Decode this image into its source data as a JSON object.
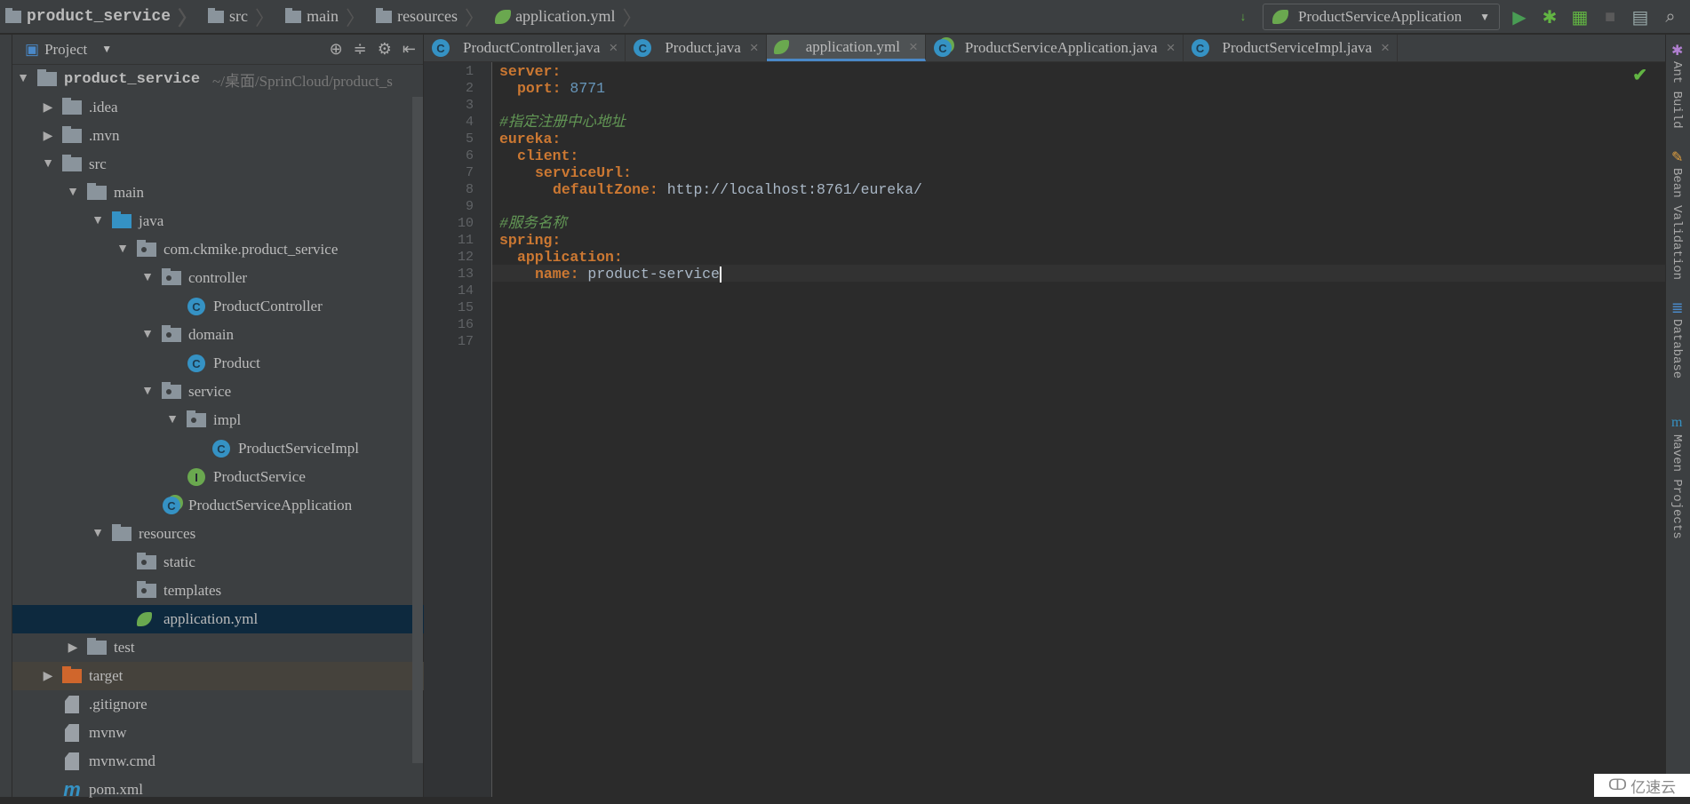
{
  "breadcrumb": [
    "product_service",
    "src",
    "main",
    "resources",
    "application.yml"
  ],
  "run_config": "ProductServiceApplication",
  "sidebar": {
    "title": "Project",
    "tree": [
      {
        "label": "product_service",
        "hint": "~/桌面/SprinCloud/product_s",
        "level": 0,
        "arrow": "down",
        "icon": "module-folder",
        "bold": true
      },
      {
        "label": ".idea",
        "level": 1,
        "arrow": "right",
        "icon": "folder"
      },
      {
        "label": ".mvn",
        "level": 1,
        "arrow": "right",
        "icon": "folder"
      },
      {
        "label": "src",
        "level": 1,
        "arrow": "down",
        "icon": "folder"
      },
      {
        "label": "main",
        "level": 2,
        "arrow": "down",
        "icon": "folder"
      },
      {
        "label": "java",
        "level": 3,
        "arrow": "down",
        "icon": "source-folder"
      },
      {
        "label": "com.ckmike.product_service",
        "level": 4,
        "arrow": "down",
        "icon": "package"
      },
      {
        "label": "controller",
        "level": 5,
        "arrow": "down",
        "icon": "package"
      },
      {
        "label": "ProductController",
        "level": 6,
        "icon": "class"
      },
      {
        "label": "domain",
        "level": 5,
        "arrow": "down",
        "icon": "package"
      },
      {
        "label": "Product",
        "level": 6,
        "icon": "class"
      },
      {
        "label": "service",
        "level": 5,
        "arrow": "down",
        "icon": "package"
      },
      {
        "label": "impl",
        "level": 6,
        "arrow": "down",
        "icon": "package"
      },
      {
        "label": "ProductServiceImpl",
        "level": 7,
        "icon": "class"
      },
      {
        "label": "ProductService",
        "level": 6,
        "icon": "interface"
      },
      {
        "label": "ProductServiceApplication",
        "level": 5,
        "icon": "spring-class"
      },
      {
        "label": "resources",
        "level": 3,
        "arrow": "down",
        "icon": "resources-folder"
      },
      {
        "label": "static",
        "level": 4,
        "icon": "package"
      },
      {
        "label": "templates",
        "level": 4,
        "icon": "package"
      },
      {
        "label": "application.yml",
        "level": 4,
        "icon": "spring-yml",
        "selected": true
      },
      {
        "label": "test",
        "level": 2,
        "arrow": "right",
        "icon": "folder"
      },
      {
        "label": "target",
        "level": 1,
        "arrow": "right",
        "icon": "excluded-folder",
        "highlight": true
      },
      {
        "label": ".gitignore",
        "level": 1,
        "icon": "file"
      },
      {
        "label": "mvnw",
        "level": 1,
        "icon": "file"
      },
      {
        "label": "mvnw.cmd",
        "level": 1,
        "icon": "file"
      },
      {
        "label": "pom.xml",
        "level": 1,
        "icon": "maven"
      }
    ]
  },
  "tabs": [
    {
      "label": "ProductController.java",
      "icon": "class",
      "active": false
    },
    {
      "label": "Product.java",
      "icon": "class",
      "active": false
    },
    {
      "label": "application.yml",
      "icon": "spring-yml",
      "active": true
    },
    {
      "label": "ProductServiceApplication.java",
      "icon": "spring-class",
      "active": false
    },
    {
      "label": "ProductServiceImpl.java",
      "icon": "class",
      "active": false
    }
  ],
  "editor": {
    "cursor_line": 13,
    "lines": [
      {
        "indent": 0,
        "key": "server"
      },
      {
        "indent": 1,
        "key": "port",
        "value": "8771",
        "vtype": "n"
      },
      {},
      {
        "indent": 0,
        "comment": "#指定注册中心地址"
      },
      {
        "indent": 0,
        "key": "eureka"
      },
      {
        "indent": 1,
        "key": "client"
      },
      {
        "indent": 2,
        "key": "serviceUrl"
      },
      {
        "indent": 3,
        "key": "defaultZone",
        "value": "http://localhost:8761/eureka/",
        "vtype": "s"
      },
      {},
      {
        "indent": 0,
        "comment": "#服务名称"
      },
      {
        "indent": 0,
        "key": "spring"
      },
      {
        "indent": 1,
        "key": "application"
      },
      {
        "indent": 2,
        "key": "name",
        "value": "product-service",
        "vtype": "s"
      },
      {},
      {},
      {},
      {}
    ]
  },
  "right_tools": [
    "Ant Build",
    "Bean Validation",
    "Database",
    "Maven Projects"
  ],
  "watermark": "亿速云",
  "colors": {
    "key": "#cc7832",
    "number": "#6897bb",
    "comment": "#629755",
    "selection": "#0d293e",
    "accent": "#4a88c7"
  }
}
